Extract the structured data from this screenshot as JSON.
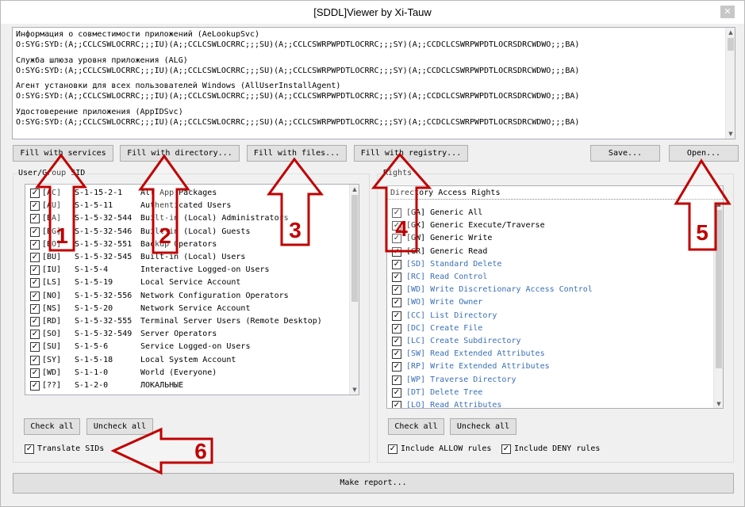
{
  "window": {
    "title": "[SDDL]Viewer by Xi-Tauw",
    "close_glyph": "✕"
  },
  "output": {
    "services": [
      {
        "name": "Информация о совместимости приложений (AeLookupSvc)",
        "sddl": "O:SYG:SYD:(A;;CCLCSWLOCRRC;;;IU)(A;;CCLCSWLOCRRC;;;SU)(A;;CCLCSWRPWPDTLOCRRC;;;SY)(A;;CCDCLCSWRPWPDTLOCRSDRCWDWO;;;BA)"
      },
      {
        "name": "Служба шлюза уровня приложения (ALG)",
        "sddl": "O:SYG:SYD:(A;;CCLCSWLOCRRC;;;IU)(A;;CCLCSWLOCRRC;;;SU)(A;;CCLCSWRPWPDTLOCRRC;;;SY)(A;;CCDCLCSWRPWPDTLOCRSDRCWDWO;;;BA)"
      },
      {
        "name": "Агент установки для всех пользователей Windows (AllUserInstallAgent)",
        "sddl": "O:SYG:SYD:(A;;CCLCSWLOCRRC;;;IU)(A;;CCLCSWLOCRRC;;;SU)(A;;CCLCSWRPWPDTLOCRRC;;;SY)(A;;CCDCLCSWRPWPDTLOCRSDRCWDWO;;;BA)"
      },
      {
        "name": "Удостоверение приложения (AppIDSvc)",
        "sddl": "O:SYG:SYD:(A;;CCLCSWLOCRRC;;;IU)(A;;CCLCSWLOCRRC;;;SU)(A;;CCLCSWRPWPDTLOCRRC;;;SY)(A;;CCDCLCSWRPWPDTLOCRSDRCWDWO;;;BA)"
      }
    ]
  },
  "toolbar": {
    "fill_services": "Fill with services",
    "fill_directory": "Fill with directory...",
    "fill_files": "Fill with files...",
    "fill_registry": "Fill with registry...",
    "save": "Save...",
    "open": "Open..."
  },
  "sid_group": {
    "label": "User/Group SID",
    "items": [
      {
        "abbr": "[AC]",
        "sid": "S-1-15-2-1",
        "name": "All App Packages"
      },
      {
        "abbr": "[AU]",
        "sid": "S-1-5-11",
        "name": "Authenticated Users"
      },
      {
        "abbr": "[BA]",
        "sid": "S-1-5-32-544",
        "name": "Built-in (Local) Administrators"
      },
      {
        "abbr": "[BG]",
        "sid": "S-1-5-32-546",
        "name": "Built-in (Local) Guests"
      },
      {
        "abbr": "[BO]",
        "sid": "S-1-5-32-551",
        "name": "Backup Operators"
      },
      {
        "abbr": "[BU]",
        "sid": "S-1-5-32-545",
        "name": "Built-in (Local) Users"
      },
      {
        "abbr": "[IU]",
        "sid": "S-1-5-4",
        "name": "Interactive Logged-on Users"
      },
      {
        "abbr": "[LS]",
        "sid": "S-1-5-19",
        "name": "Local Service Account"
      },
      {
        "abbr": "[NO]",
        "sid": "S-1-5-32-556",
        "name": "Network Configuration Operators"
      },
      {
        "abbr": "[NS]",
        "sid": "S-1-5-20",
        "name": "Network Service Account"
      },
      {
        "abbr": "[RD]",
        "sid": "S-1-5-32-555",
        "name": "Terminal Server Users (Remote Desktop)"
      },
      {
        "abbr": "[SO]",
        "sid": "S-1-5-32-549",
        "name": "Server Operators"
      },
      {
        "abbr": "[SU]",
        "sid": "S-1-5-6",
        "name": "Service Logged-on Users"
      },
      {
        "abbr": "[SY]",
        "sid": "S-1-5-18",
        "name": "Local System Account"
      },
      {
        "abbr": "[WD]",
        "sid": "S-1-1-0",
        "name": "World (Everyone)"
      },
      {
        "abbr": "[??]",
        "sid": "S-1-2-0",
        "name": "ЛОКАЛЬНЫЕ"
      }
    ],
    "check_all": "Check all",
    "uncheck_all": "Uncheck all",
    "translate_sids": "Translate SIDs"
  },
  "rights_group": {
    "label": "Rights",
    "header": "Directory Access Rights",
    "items": [
      {
        "text": "[GA] Generic All",
        "kind": "generic"
      },
      {
        "text": "[GX] Generic Execute/Traverse",
        "kind": "generic"
      },
      {
        "text": "[GW] Generic Write",
        "kind": "generic"
      },
      {
        "text": "[GR] Generic Read",
        "kind": "generic"
      },
      {
        "text": "[SD] Standard Delete",
        "kind": "specific"
      },
      {
        "text": "[RC] Read Control",
        "kind": "specific"
      },
      {
        "text": "[WD] Write Discretionary Access Control",
        "kind": "specific"
      },
      {
        "text": "[WO] Write Owner",
        "kind": "specific"
      },
      {
        "text": "[CC] List Directory",
        "kind": "specific"
      },
      {
        "text": "[DC] Create File",
        "kind": "specific"
      },
      {
        "text": "[LC] Create Subdirectory",
        "kind": "specific"
      },
      {
        "text": "[SW] Read Extended Attributes",
        "kind": "specific"
      },
      {
        "text": "[RP] Write Extended Attributes",
        "kind": "specific"
      },
      {
        "text": "[WP] Traverse Directory",
        "kind": "specific"
      },
      {
        "text": "[DT] Delete Tree",
        "kind": "specific"
      },
      {
        "text": "[LO] Read Attributes",
        "kind": "specific"
      }
    ],
    "check_all": "Check all",
    "uncheck_all": "Uncheck all",
    "include_allow": "Include ALLOW rules",
    "include_deny": "Include DENY rules"
  },
  "make_report": "Make report...",
  "annotations": {
    "color": "#c00000",
    "labels": [
      "1",
      "2",
      "3",
      "4",
      "5",
      "6"
    ]
  },
  "colors": {
    "specific_right": "#3a6fb5",
    "arrow": "#c00000"
  }
}
